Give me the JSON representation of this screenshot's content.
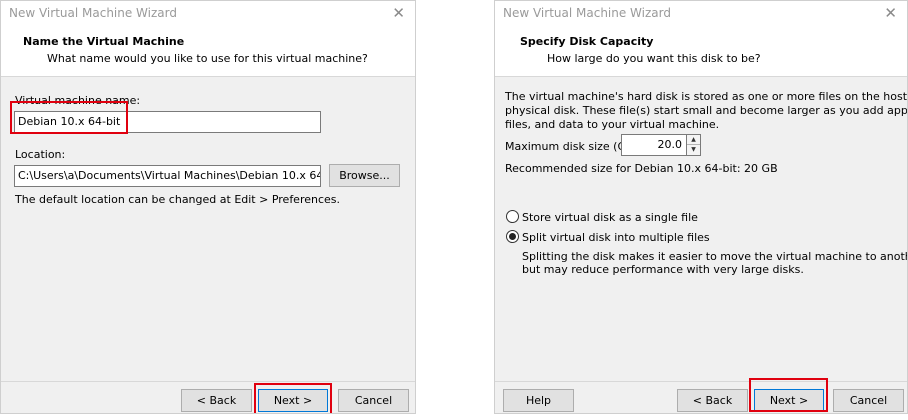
{
  "dialog1": {
    "title": "New Virtual Machine Wizard",
    "close_glyph": "✕",
    "header_title": "Name the Virtual Machine",
    "header_subtitle": "What name would you like to use for this virtual machine?",
    "name_label": "Virtual machine name:",
    "name_value": "Debian 10.x 64-bit",
    "location_label": "Location:",
    "location_value": "C:\\Users\\a\\Documents\\Virtual Machines\\Debian 10.x 64-bit",
    "browse_label": "Browse...",
    "hint": "The default location can be changed at Edit > Preferences.",
    "back_label": "< Back",
    "next_label": "Next >",
    "cancel_label": "Cancel"
  },
  "dialog2": {
    "title": "New Virtual Machine Wizard",
    "close_glyph": "✕",
    "header_title": "Specify Disk Capacity",
    "header_subtitle": "How large do you want this disk to be?",
    "desc_line1": "The virtual machine's hard disk is stored as one or more files on the host computer's",
    "desc_line2": "physical disk. These file(s) start small and become larger as you add applications,",
    "desc_line3": "files, and data to your virtual machine.",
    "max_size_label": "Maximum disk size (GB):",
    "max_size_value": "20.0",
    "recommended": "Recommended size for Debian 10.x 64-bit: 20 GB",
    "option_single": "Store virtual disk as a single file",
    "option_split": "Split virtual disk into multiple files",
    "selected_option": "split",
    "split_desc_line1": "Splitting the disk makes it easier to move the virtual machine to another computer",
    "split_desc_line2": "but may reduce performance with very large disks.",
    "help_label": "Help",
    "back_label": "< Back",
    "next_label": "Next >",
    "cancel_label": "Cancel"
  },
  "colors": {
    "highlight": "#e0000f",
    "dialog_bg": "#f0f0f0",
    "button_bg": "#e1e1e1"
  }
}
